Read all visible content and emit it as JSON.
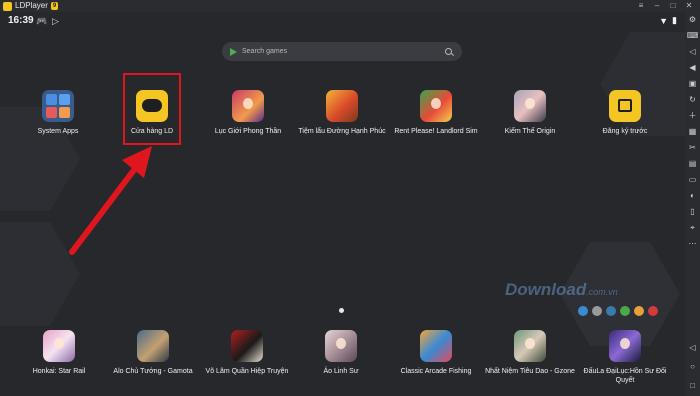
{
  "window": {
    "title": "LDPlayer",
    "badge": "9",
    "controls": [
      "minimize-icon",
      "maximize-icon",
      "restore-icon",
      "close-icon"
    ]
  },
  "statusbar": {
    "time": "16:39",
    "icons": [
      "gamepad-icon",
      "play-store-icon",
      "wifi-icon",
      "battery-icon"
    ]
  },
  "search": {
    "placeholder": "Search games"
  },
  "apps_top": [
    {
      "name": "System Apps"
    },
    {
      "name": "Cửa hàng LD"
    },
    {
      "name": "Lục Giới Phong Thần"
    },
    {
      "name": "Tiệm lẩu Đường Hạnh Phúc"
    },
    {
      "name": "Rent Please! Landlord Sim"
    },
    {
      "name": "Kiếm Thế Origin"
    },
    {
      "name": "Đăng ký trước"
    }
  ],
  "apps_dock": [
    {
      "name": "Honkai: Star Rail"
    },
    {
      "name": "Alo Chủ Tướng - Gamota"
    },
    {
      "name": "Võ Lâm Quần Hiệp Truyện"
    },
    {
      "name": "Ảo Linh Sư"
    },
    {
      "name": "Classic Arcade Fishing"
    },
    {
      "name": "Nhất Niệm Tiêu Dao - Gzone"
    },
    {
      "name": "ĐấuLa ĐạiLục:Hồn Sư Đối Quyết"
    }
  ],
  "watermark": {
    "text": "Download",
    "suffix": ".com.vn",
    "colors": [
      "#3a8ad4",
      "#9a9a9a",
      "#3a7ab0",
      "#4aa84a",
      "#e8a03a",
      "#d43a3a"
    ]
  },
  "highlight_color": "#e0161f",
  "sidebar_icons": [
    "settings-icon",
    "keyboard-icon",
    "volume-up-icon",
    "volume-down-icon",
    "screen-icon",
    "rotate-icon",
    "add-apk-icon",
    "record-icon",
    "scissors-icon",
    "resolution-icon",
    "sync-icon",
    "operation-icon",
    "shake-icon",
    "location-icon",
    "more-icon"
  ],
  "nav_icons": [
    "back-icon",
    "home-icon",
    "recents-icon"
  ]
}
